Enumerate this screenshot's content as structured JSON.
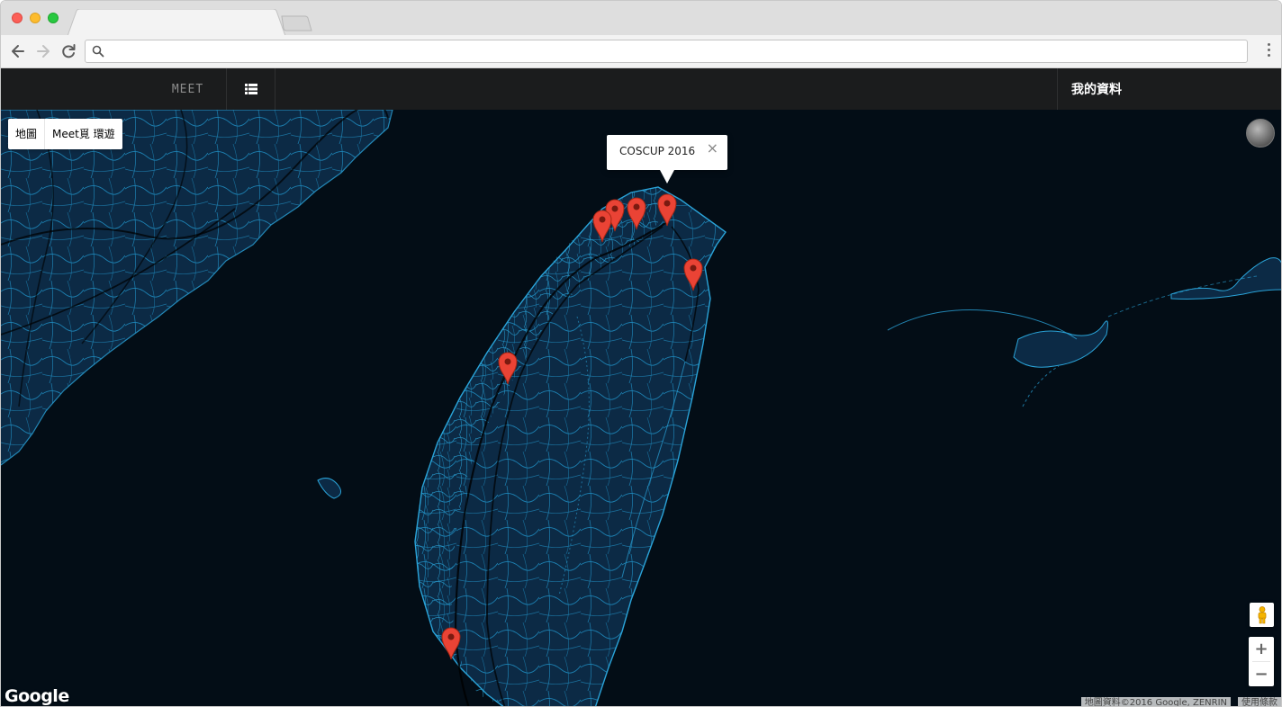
{
  "browser": {
    "tab_title": "",
    "address_value": "",
    "address_placeholder": ""
  },
  "navbar": {
    "brand": "MEET",
    "profile_label": "我的資料"
  },
  "map": {
    "maptype_buttons": [
      "地圖",
      "Meet覓 環遊"
    ],
    "infowindow_title": "COSCUP 2016",
    "infowindow_close": "×",
    "zoom_in": "+",
    "zoom_out": "−",
    "logo": "Google",
    "attribution": "地圖資料©2016 Google, ZENRIN",
    "terms": "使用條款",
    "marker_color": "#ea4335",
    "background_color": "#030d16",
    "land_color": "#0c2a45",
    "road_color": "#1f8fc4"
  }
}
